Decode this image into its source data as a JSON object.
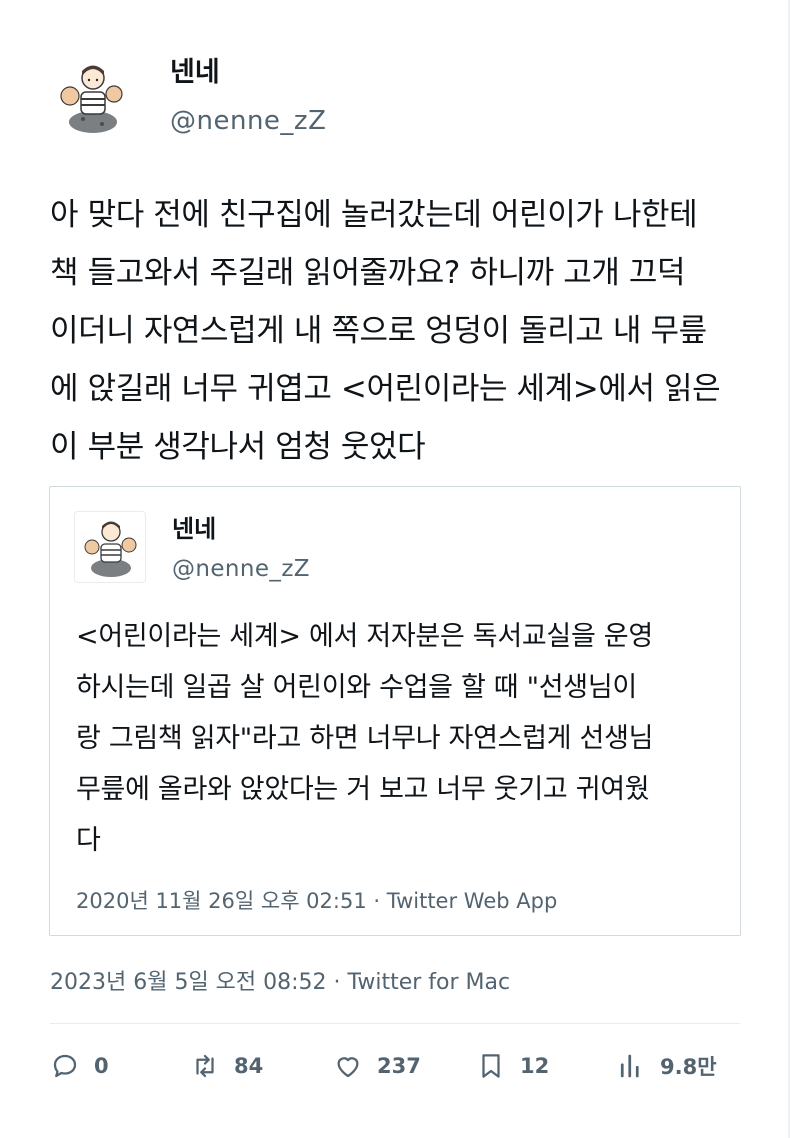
{
  "author": {
    "display_name": "넨네",
    "handle": "@nenne_zZ"
  },
  "tweet": {
    "text": "아 맞다 전에 친구집에 놀러갔는데 어린이가 나한테\n책 들고와서 주길래 읽어줄까요? 하니까 고개 끄덕\n이더니 자연스럽게 내 쪽으로 엉덩이 돌리고 내 무릎\n에 앉길래 너무 귀엽고 <어린이라는 세계>에서 읽은\n이 부분 생각나서 엄청 웃었다",
    "meta": "2023년 6월 5일 오전 08:52 · Twitter for Mac"
  },
  "quoted_tweet": {
    "display_name": "넨네",
    "handle": "@nenne_zZ",
    "text": "<어린이라는 세계> 에서 저자분은 독서교실을 운영\n하시는데 일곱 살 어린이와 수업을 할 때 \"선생님이\n랑 그림책 읽자\"라고 하면 너무나 자연스럽게 선생님\n무릎에 올라와 앉았다는 거 보고 너무 웃기고 귀여웠\n다",
    "meta": "2020년 11월 26일 오후 02:51 · Twitter Web App"
  },
  "actions": {
    "reply_count": "0",
    "retweet_count": "84",
    "like_count": "237",
    "bookmark_count": "12",
    "views_count": "9.8만"
  },
  "icons": {
    "reply": "reply-icon",
    "retweet": "retweet-icon",
    "like": "heart-icon",
    "bookmark": "bookmark-icon",
    "views": "views-icon"
  },
  "colors": {
    "text": "#0f1419",
    "secondary": "#536471",
    "border": "#cfd9de"
  }
}
